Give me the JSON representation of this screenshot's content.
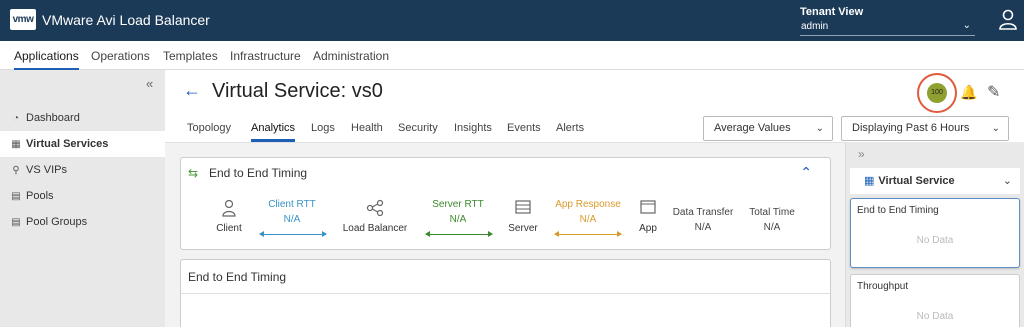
{
  "header": {
    "logo": "vmw",
    "app_title": "VMware Avi Load Balancer",
    "tenant_label": "Tenant View",
    "tenant_value": "admin"
  },
  "topnav": [
    "Applications",
    "Operations",
    "Templates",
    "Infrastructure",
    "Administration"
  ],
  "sidebar": {
    "items": [
      {
        "label": "Dashboard",
        "icon": "dashboard-icon"
      },
      {
        "label": "Virtual Services",
        "icon": "grid-icon"
      },
      {
        "label": "VS VIPs",
        "icon": "pin-icon"
      },
      {
        "label": "Pools",
        "icon": "server-icon"
      },
      {
        "label": "Pool Groups",
        "icon": "server-group-icon"
      }
    ]
  },
  "main": {
    "title": "Virtual Service:  vs0",
    "health_score": "100",
    "tabs": [
      "Topology",
      "Analytics",
      "Logs",
      "Health",
      "Security",
      "Insights",
      "Events",
      "Alerts"
    ],
    "values_dropdown": "Average Values",
    "time_dropdown": "Displaying Past 6 Hours"
  },
  "timing_card": {
    "title": "End to End Timing",
    "nodes": {
      "client": "Client",
      "load_balancer": "Load Balancer",
      "server": "Server",
      "app": "App"
    },
    "metrics": {
      "client_rtt": {
        "name": "Client RTT",
        "value": "N/A"
      },
      "server_rtt": {
        "name": "Server RTT",
        "value": "N/A"
      },
      "app_response": {
        "name": "App Response",
        "value": "N/A"
      },
      "data_transfer": {
        "name": "Data Transfer",
        "value": "N/A"
      },
      "total_time": {
        "name": "Total Time",
        "value": "N/A"
      }
    }
  },
  "chart_card": {
    "title": "End to End Timing"
  },
  "right_panel": {
    "header": "Virtual Service",
    "cards": [
      {
        "title": "End to End Timing",
        "status": "No Data"
      },
      {
        "title": "Throughput",
        "status": "No Data"
      }
    ]
  },
  "colors": {
    "header_bg": "#1b3a57",
    "accent": "#1d5fb6",
    "client_rtt": "#3a93c8",
    "server_rtt": "#3c8a2e",
    "app_response": "#d89a2a",
    "health_badge": "#8fa030",
    "highlight_ring": "#e05a3c"
  }
}
